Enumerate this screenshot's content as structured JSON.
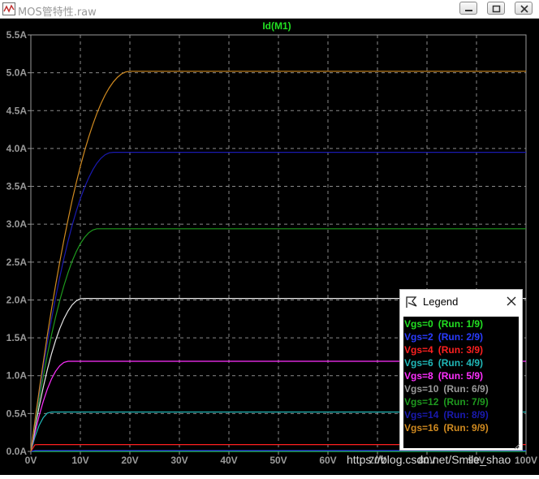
{
  "window": {
    "title": "MOS管特性.raw",
    "icon": "waveform-app-icon",
    "controls": [
      "minimize-icon",
      "restore-icon",
      "close-icon"
    ]
  },
  "plot": {
    "trace_title": "Id(M1)",
    "background": "#000000",
    "grid_color": "#8a8a8a",
    "tick_color": "#9a9a9a"
  },
  "legend": {
    "title": "Legend",
    "items": [
      {
        "label": "Vgs=0",
        "run": "(Run: 1/9)",
        "color": "#22e022"
      },
      {
        "label": "Vgs=2",
        "run": "(Run: 2/9)",
        "color": "#2a3cff"
      },
      {
        "label": "Vgs=4",
        "run": "(Run: 3/9)",
        "color": "#ff2020"
      },
      {
        "label": "Vgs=6",
        "run": "(Run: 4/9)",
        "color": "#20b8b8"
      },
      {
        "label": "Vgs=8",
        "run": "(Run: 5/9)",
        "color": "#ff30ff"
      },
      {
        "label": "Vgs=10",
        "run": "(Run: 6/9)",
        "color": "#9a9a9a"
      },
      {
        "label": "Vgs=12",
        "run": "(Run: 7/9)",
        "color": "#1e9a1e"
      },
      {
        "label": "Vgs=14",
        "run": "(Run: 8/9)",
        "color": "#1a1ab0"
      },
      {
        "label": "Vgs=16",
        "run": "(Run: 9/9)",
        "color": "#d08a20"
      }
    ]
  },
  "watermark": "https://blog.csdn.net/Smile_shao",
  "chart_data": {
    "type": "line",
    "title": "Id(M1)",
    "xlabel": "",
    "ylabel": "",
    "xlim": [
      0,
      100
    ],
    "ylim": [
      0,
      5.5
    ],
    "x_unit": "V",
    "y_unit": "A",
    "x_ticks": [
      "0V",
      "10V",
      "20V",
      "30V",
      "40V",
      "50V",
      "60V",
      "70V",
      "80V",
      "90V",
      "100V"
    ],
    "y_ticks": [
      "0.0A",
      "0.5A",
      "1.0A",
      "1.5A",
      "2.0A",
      "2.5A",
      "3.0A",
      "3.5A",
      "4.0A",
      "4.5A",
      "5.0A",
      "5.5A"
    ],
    "grid": true,
    "legend_position": "bottom-right",
    "series": [
      {
        "name": "Vgs=0",
        "saturation_current": 0.0,
        "knee_voltage": 0,
        "color": "#22e022"
      },
      {
        "name": "Vgs=2",
        "saturation_current": 0.01,
        "knee_voltage": 0.5,
        "color": "#2a3cff"
      },
      {
        "name": "Vgs=4",
        "saturation_current": 0.09,
        "knee_voltage": 1.0,
        "color": "#ff2020"
      },
      {
        "name": "Vgs=6",
        "saturation_current": 0.52,
        "knee_voltage": 4.0,
        "color": "#20b8b8"
      },
      {
        "name": "Vgs=8",
        "saturation_current": 1.19,
        "knee_voltage": 7.5,
        "color": "#ff30ff"
      },
      {
        "name": "Vgs=10",
        "saturation_current": 2.02,
        "knee_voltage": 10.5,
        "color": "#e8e8e8"
      },
      {
        "name": "Vgs=12",
        "saturation_current": 2.94,
        "knee_voltage": 13.5,
        "color": "#1e9a1e"
      },
      {
        "name": "Vgs=14",
        "saturation_current": 3.95,
        "knee_voltage": 16.5,
        "color": "#1a1ab0"
      },
      {
        "name": "Vgs=16",
        "saturation_current": 5.02,
        "knee_voltage": 20.0,
        "color": "#d08a20"
      }
    ]
  }
}
